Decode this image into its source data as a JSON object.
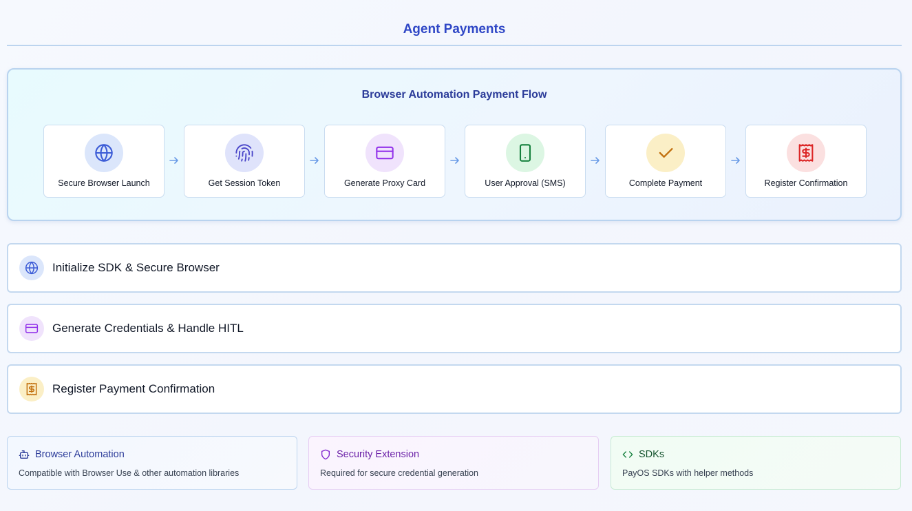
{
  "page": {
    "title": "Agent Payments"
  },
  "flow": {
    "title": "Browser Automation Payment Flow",
    "steps": [
      {
        "label": "Secure Browser Launch",
        "icon": "globe-icon",
        "bg": "#dbe6fb",
        "fg": "#3b5bd6"
      },
      {
        "label": "Get Session Token",
        "icon": "fingerprint-icon",
        "bg": "#dfe3fb",
        "fg": "#4a46c9"
      },
      {
        "label": "Generate Proxy Card",
        "icon": "credit-card-icon",
        "bg": "#f0e3fc",
        "fg": "#9333ea"
      },
      {
        "label": "User Approval (SMS)",
        "icon": "smartphone-icon",
        "bg": "#dcf6e3",
        "fg": "#15803d"
      },
      {
        "label": "Complete Payment",
        "icon": "check-icon",
        "bg": "#fbefc6",
        "fg": "#c2700e"
      },
      {
        "label": "Register Confirmation",
        "icon": "receipt-dollar-icon",
        "bg": "#fbe0e0",
        "fg": "#dc2626"
      }
    ],
    "arrow_icon": "arrow-right-icon"
  },
  "sections": [
    {
      "label": "Initialize SDK & Secure Browser",
      "icon": "globe-icon",
      "bg": "#dbe6fb",
      "fg": "#3b5bd6"
    },
    {
      "label": "Generate Credentials & Handle HITL",
      "icon": "credit-card-icon",
      "bg": "#f0e3fc",
      "fg": "#9333ea"
    },
    {
      "label": "Register Payment Confirmation",
      "icon": "receipt-dollar-icon",
      "bg": "#fbefc6",
      "fg": "#c2700e"
    }
  ],
  "cards": [
    {
      "title": "Browser Automation",
      "desc": "Compatible with Browser Use & other automation libraries",
      "icon": "bot-icon",
      "color": "#2b3b99",
      "border": "#bcd4ef"
    },
    {
      "title": "Security Extension",
      "desc": "Required for secure credential generation",
      "icon": "shield-icon",
      "color": "#6b21a8",
      "border": "#e6cdf3"
    },
    {
      "title": "SDKs",
      "desc": "PayOS SDKs with helper methods",
      "icon": "code-icon",
      "color": "#14532d",
      "border": "#c6ebd2"
    }
  ]
}
